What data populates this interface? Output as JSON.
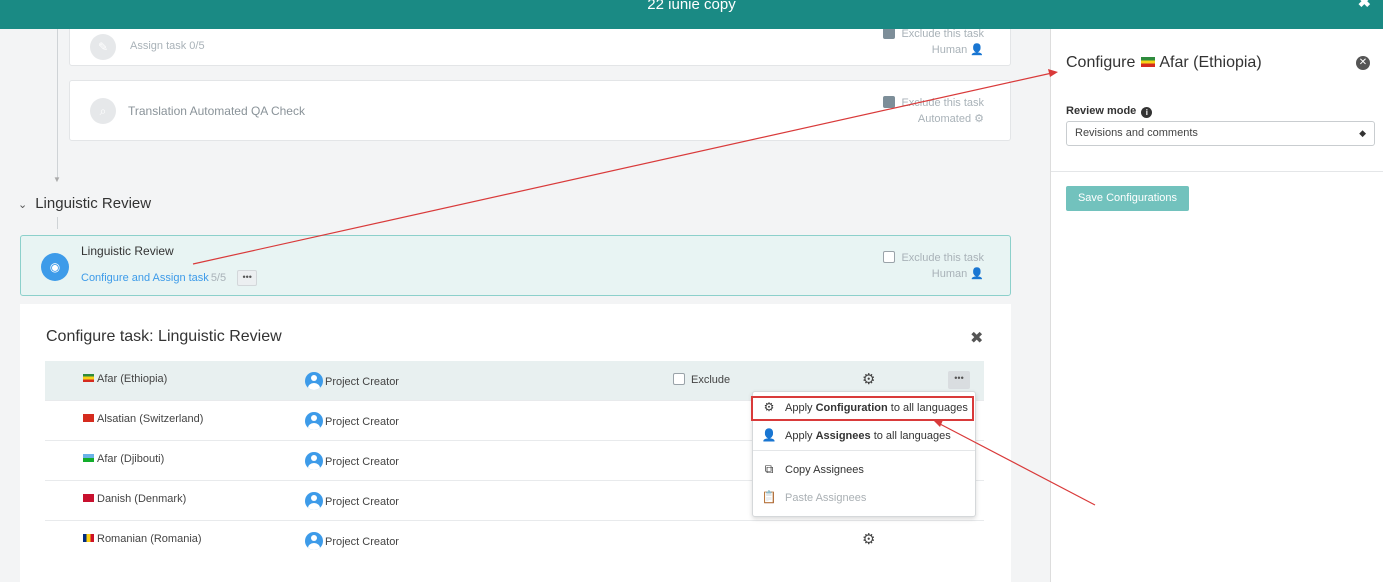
{
  "window": {
    "title": "22 iunie copy"
  },
  "tasks": {
    "assign": {
      "label": "Assign task 0/5",
      "exclude_label": "Exclude this task",
      "type": "Human"
    },
    "qa": {
      "label": "Translation Automated QA Check",
      "exclude_label": "Exclude this task",
      "type": "Automated"
    }
  },
  "section": {
    "title": "Linguistic Review"
  },
  "lr_card": {
    "name": "Linguistic Review",
    "link": "Configure and Assign task",
    "count": "5/5",
    "dots": "•••",
    "exclude_label": "Exclude this task",
    "type": "Human"
  },
  "configure_task": {
    "title": "Configure task: Linguistic Review",
    "rows": [
      {
        "language": "Afar (Ethiopia)",
        "flag_color": "#2e8b3d",
        "assignee": "Project Creator",
        "exclude": "Exclude",
        "gear": true
      },
      {
        "language": "Alsatian (Switzerland)",
        "flag_color": "#d52b1e",
        "assignee": "Project Creator"
      },
      {
        "language": "Afar (Djibouti)",
        "flag_color": "#6ab2e7",
        "assignee": "Project Creator"
      },
      {
        "language": "Danish (Denmark)",
        "flag_color": "#c8102e",
        "assignee": "Project Creator"
      },
      {
        "language": "Romanian (Romania)",
        "flag_color": "#002b7f",
        "assignee": "Project Creator",
        "gear": true
      }
    ]
  },
  "context_menu": {
    "apply_config_prefix": "Apply",
    "apply_config_bold": "Configuration",
    "apply_config_suffix": "to all languages",
    "apply_assignees_prefix": "Apply",
    "apply_assignees_bold": "Assignees",
    "apply_assignees_suffix": "to all languages",
    "copy_assignees": "Copy Assignees",
    "paste_assignees": "Paste Assignees"
  },
  "side_panel": {
    "title_prefix": "Configure",
    "title_language": "Afar (Ethiopia)",
    "review_mode_label": "Review mode",
    "review_mode_value": "Revisions and comments",
    "save_label": "Save Configurations"
  },
  "colors": {
    "header": "#1a8a84",
    "accent": "#3d9be9",
    "highlight_border": "#d93a3a",
    "save_button": "#72c2bd"
  }
}
